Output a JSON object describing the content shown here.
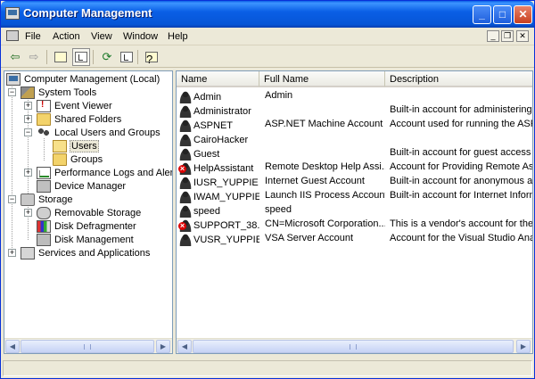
{
  "window": {
    "title": "Computer Management"
  },
  "menu": [
    "File",
    "Action",
    "View",
    "Window",
    "Help"
  ],
  "toolbar": {
    "icons": [
      "back-arrow-icon",
      "forward-arrow-icon",
      "up-folder-icon",
      "show-hide-tree-icon",
      "refresh-icon",
      "export-list-icon",
      "help-icon"
    ]
  },
  "tree": {
    "root": "Computer Management (Local)",
    "system_tools": "System Tools",
    "event_viewer": "Event Viewer",
    "shared_folders": "Shared Folders",
    "local_users_groups": "Local Users and Groups",
    "users": "Users",
    "groups": "Groups",
    "perf_logs": "Performance Logs and Alerts",
    "device_manager": "Device Manager",
    "storage": "Storage",
    "removable_storage": "Removable Storage",
    "disk_defrag": "Disk Defragmenter",
    "disk_mgmt": "Disk Management",
    "services_apps": "Services and Applications"
  },
  "list": {
    "columns": {
      "name": "Name",
      "full_name": "Full Name",
      "description": "Description"
    },
    "rows": [
      {
        "name": "Admin",
        "full_name": "Admin",
        "description": "",
        "disabled": false
      },
      {
        "name": "Administrator",
        "full_name": "",
        "description": "Built-in account for administering th",
        "disabled": false
      },
      {
        "name": "ASPNET",
        "full_name": "ASP.NET Machine Account",
        "description": "Account used for running the ASP.N",
        "disabled": false
      },
      {
        "name": "CairoHacker",
        "full_name": "",
        "description": "",
        "disabled": false
      },
      {
        "name": "Guest",
        "full_name": "",
        "description": "Built-in account for guest access to",
        "disabled": false
      },
      {
        "name": "HelpAssistant",
        "full_name": "Remote Desktop Help Assi...",
        "description": "Account for Providing Remote Assis",
        "disabled": true
      },
      {
        "name": "IUSR_YUPPIE",
        "full_name": "Internet Guest Account",
        "description": "Built-in account for anonymous acc",
        "disabled": false
      },
      {
        "name": "IWAM_YUPPIE",
        "full_name": "Launch IIS Process Account",
        "description": "Built-in account for Internet Inform",
        "disabled": false
      },
      {
        "name": "speed",
        "full_name": "speed",
        "description": "",
        "disabled": false
      },
      {
        "name": "SUPPORT_38...",
        "full_name": "CN=Microsoft Corporation...",
        "description": "This is a vendor's account for the H",
        "disabled": true
      },
      {
        "name": "VUSR_YUPPIE",
        "full_name": "VSA Server Account",
        "description": "Account for the Visual Studio Analy",
        "disabled": false
      }
    ]
  },
  "colors": {
    "titlebar": "#0a5fe6",
    "chrome": "#ece9d8",
    "pane_border": "#7f9db9"
  }
}
